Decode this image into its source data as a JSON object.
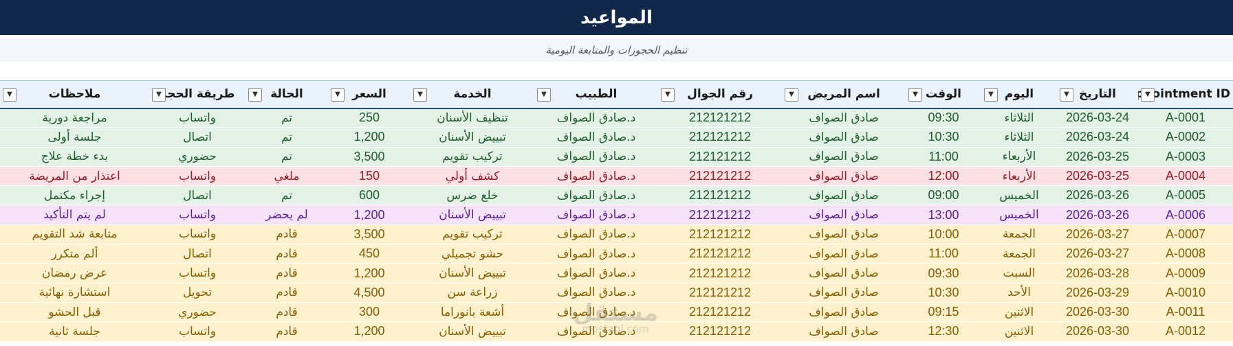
{
  "page": {
    "title": "المواعيد",
    "subtitle": "تنظيم الحجوزات والمتابعة اليومية"
  },
  "table": {
    "headers": {
      "id": "Appointment ID",
      "date": "التاريخ",
      "day": "اليوم",
      "time": "الوقت",
      "patient": "اسم المريض",
      "phone": "رقم الجوال",
      "doctor": "الطبيب",
      "service": "الخدمة",
      "price": "السعر",
      "status": "الحالة",
      "booking": "طريقة الحجز",
      "notes": "ملاحظات"
    },
    "filter_icon": "dropdown-filter-icon",
    "rows": [
      {
        "id": "A-0001",
        "date": "2026-03-24",
        "day": "الثلاثاء",
        "time": "09:30",
        "patient": "صادق الصواف",
        "phone": "212121212",
        "doctor": "د.صادق الصواف",
        "service": "تنظيف الأسنان",
        "price": "250",
        "status": "تم",
        "booking": "واتساب",
        "notes": "مراجعة دورية",
        "state": "done"
      },
      {
        "id": "A-0002",
        "date": "2026-03-24",
        "day": "الثلاثاء",
        "time": "10:30",
        "patient": "صادق الصواف",
        "phone": "212121212",
        "doctor": "د.صادق الصواف",
        "service": "تبييض الأسنان",
        "price": "1,200",
        "status": "تم",
        "booking": "اتصال",
        "notes": "جلسة أولى",
        "state": "done"
      },
      {
        "id": "A-0003",
        "date": "2026-03-25",
        "day": "الأربعاء",
        "time": "11:00",
        "patient": "صادق الصواف",
        "phone": "212121212",
        "doctor": "د.صادق الصواف",
        "service": "تركيب تقويم",
        "price": "3,500",
        "status": "تم",
        "booking": "حضوري",
        "notes": "بدء خطة علاج",
        "state": "done"
      },
      {
        "id": "A-0004",
        "date": "2026-03-25",
        "day": "الأربعاء",
        "time": "12:00",
        "patient": "صادق الصواف",
        "phone": "212121212",
        "doctor": "د.صادق الصواف",
        "service": "كشف أولي",
        "price": "150",
        "status": "ملغي",
        "booking": "واتساب",
        "notes": "اعتذار من المريضة",
        "state": "cancelled"
      },
      {
        "id": "A-0005",
        "date": "2026-03-26",
        "day": "الخميس",
        "time": "09:00",
        "patient": "صادق الصواف",
        "phone": "212121212",
        "doctor": "د.صادق الصواف",
        "service": "خلع ضرس",
        "price": "600",
        "status": "تم",
        "booking": "اتصال",
        "notes": "إجراء مكتمل",
        "state": "done"
      },
      {
        "id": "A-0006",
        "date": "2026-03-26",
        "day": "الخميس",
        "time": "13:00",
        "patient": "صادق الصواف",
        "phone": "212121212",
        "doctor": "د.صادق الصواف",
        "service": "تبييض الأسنان",
        "price": "1,200",
        "status": "لم يحضر",
        "booking": "واتساب",
        "notes": "لم يتم التأكيد",
        "state": "noshow"
      },
      {
        "id": "A-0007",
        "date": "2026-03-27",
        "day": "الجمعة",
        "time": "10:00",
        "patient": "صادق الصواف",
        "phone": "212121212",
        "doctor": "د.صادق الصواف",
        "service": "تركيب تقويم",
        "price": "3,500",
        "status": "قادم",
        "booking": "واتساب",
        "notes": "متابعة شد التقويم",
        "state": "upcoming"
      },
      {
        "id": "A-0008",
        "date": "2026-03-27",
        "day": "الجمعة",
        "time": "11:00",
        "patient": "صادق الصواف",
        "phone": "212121212",
        "doctor": "د.صادق الصواف",
        "service": "حشو تجميلي",
        "price": "450",
        "status": "قادم",
        "booking": "اتصال",
        "notes": "ألم متكرر",
        "state": "upcoming"
      },
      {
        "id": "A-0009",
        "date": "2026-03-28",
        "day": "السبت",
        "time": "09:30",
        "patient": "صادق الصواف",
        "phone": "212121212",
        "doctor": "د.صادق الصواف",
        "service": "تبييض الأسنان",
        "price": "1,200",
        "status": "قادم",
        "booking": "واتساب",
        "notes": "عرض رمضان",
        "state": "upcoming"
      },
      {
        "id": "A-0010",
        "date": "2026-03-29",
        "day": "الأحد",
        "time": "10:30",
        "patient": "صادق الصواف",
        "phone": "212121212",
        "doctor": "د.صادق الصواف",
        "service": "زراعة سن",
        "price": "4,500",
        "status": "قادم",
        "booking": "تحويل",
        "notes": "استشارة نهائية",
        "state": "upcoming"
      },
      {
        "id": "A-0011",
        "date": "2026-03-30",
        "day": "الاثنين",
        "time": "09:15",
        "patient": "صادق الصواف",
        "phone": "212121212",
        "doctor": "د.صادق الصواف",
        "service": "أشعة بانوراما",
        "price": "300",
        "status": "قادم",
        "booking": "حضوري",
        "notes": "قبل الحشو",
        "state": "upcoming"
      },
      {
        "id": "A-0012",
        "date": "2026-03-30",
        "day": "الاثنين",
        "time": "12:30",
        "patient": "صادق الصواف",
        "phone": "212121212",
        "doctor": "د.صادق الصواف",
        "service": "تبييض الأسنان",
        "price": "1,200",
        "status": "قادم",
        "booking": "واتساب",
        "notes": "جلسة ثانية",
        "state": "upcoming"
      }
    ]
  },
  "watermark": {
    "text": "مستقل",
    "sub": "mostaql.com"
  }
}
